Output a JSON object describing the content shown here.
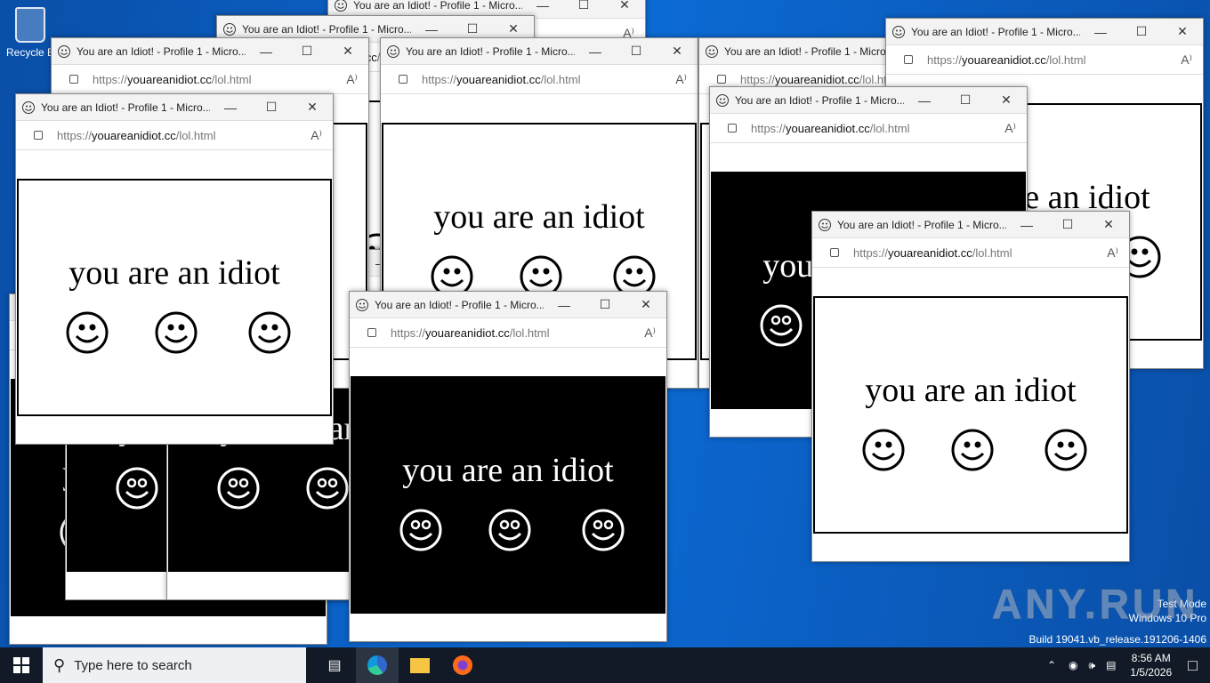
{
  "desktop": {
    "recycle_bin_label": "Recycle B",
    "watermark": {
      "line1": "Test Mode",
      "line2": "Windows 10 Pro",
      "line3": "Build 19041.vb_release.191206-1406"
    },
    "anyrun": "ANY.RUN"
  },
  "window_common": {
    "title": "You are an Idiot! - Profile 1 - Micro...",
    "url_scheme": "https://",
    "url_host": "youareanidiot.cc",
    "url_path": "/lol.html",
    "message": "you are an idiot",
    "read_aloud": "A⁾"
  },
  "windows": [
    {
      "theme": "white"
    },
    {
      "theme": "white"
    },
    {
      "theme": "black"
    },
    {
      "theme": "black"
    },
    {
      "theme": "black"
    },
    {
      "theme": "white"
    },
    {
      "theme": "white"
    },
    {
      "theme": "white"
    },
    {
      "theme": "white"
    },
    {
      "theme": "black"
    },
    {
      "theme": "white"
    },
    {
      "theme": "white"
    },
    {
      "theme": "black"
    }
  ],
  "taskbar": {
    "search_placeholder": "Type here to search",
    "clock_time": "8:56 AM",
    "clock_date": "1/5/2026"
  },
  "colors": {
    "desktop": "#0b63c5",
    "taskbar": "#111a26"
  }
}
